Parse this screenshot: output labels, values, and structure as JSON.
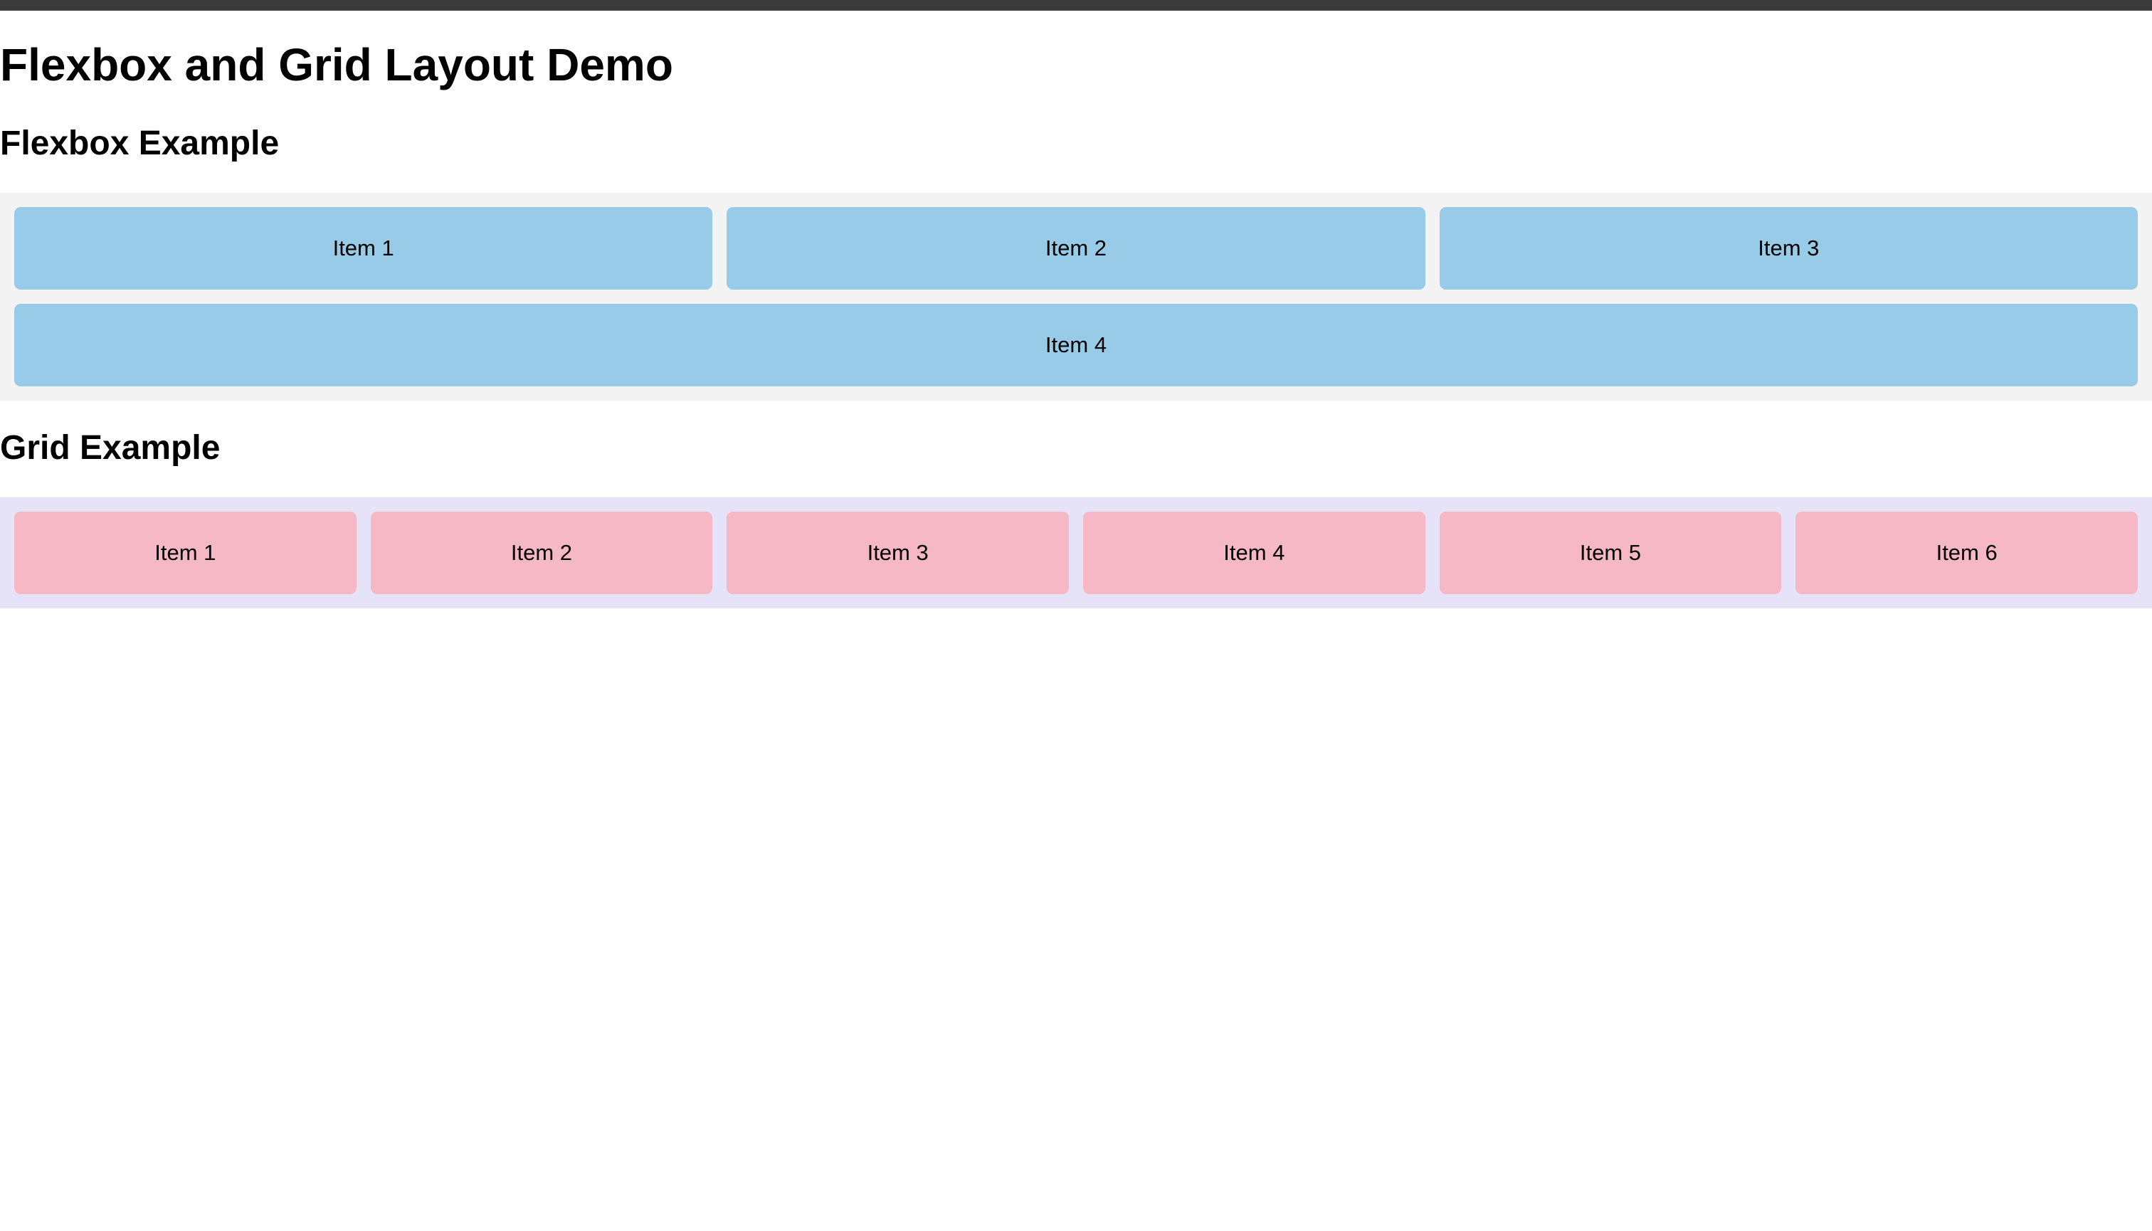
{
  "header": {
    "title": "Flexbox and Grid Layout Demo"
  },
  "flexbox_section": {
    "title": "Flexbox Example",
    "background": "#f3f3f3",
    "item_color": "#98cbe8",
    "items": [
      "Item 1",
      "Item 2",
      "Item 3",
      "Item 4"
    ]
  },
  "grid_section": {
    "title": "Grid Example",
    "background": "#e6e2f8",
    "item_color": "#f5b8c4",
    "items": [
      "Item 1",
      "Item 2",
      "Item 3",
      "Item 4",
      "Item 5",
      "Item 6"
    ]
  }
}
